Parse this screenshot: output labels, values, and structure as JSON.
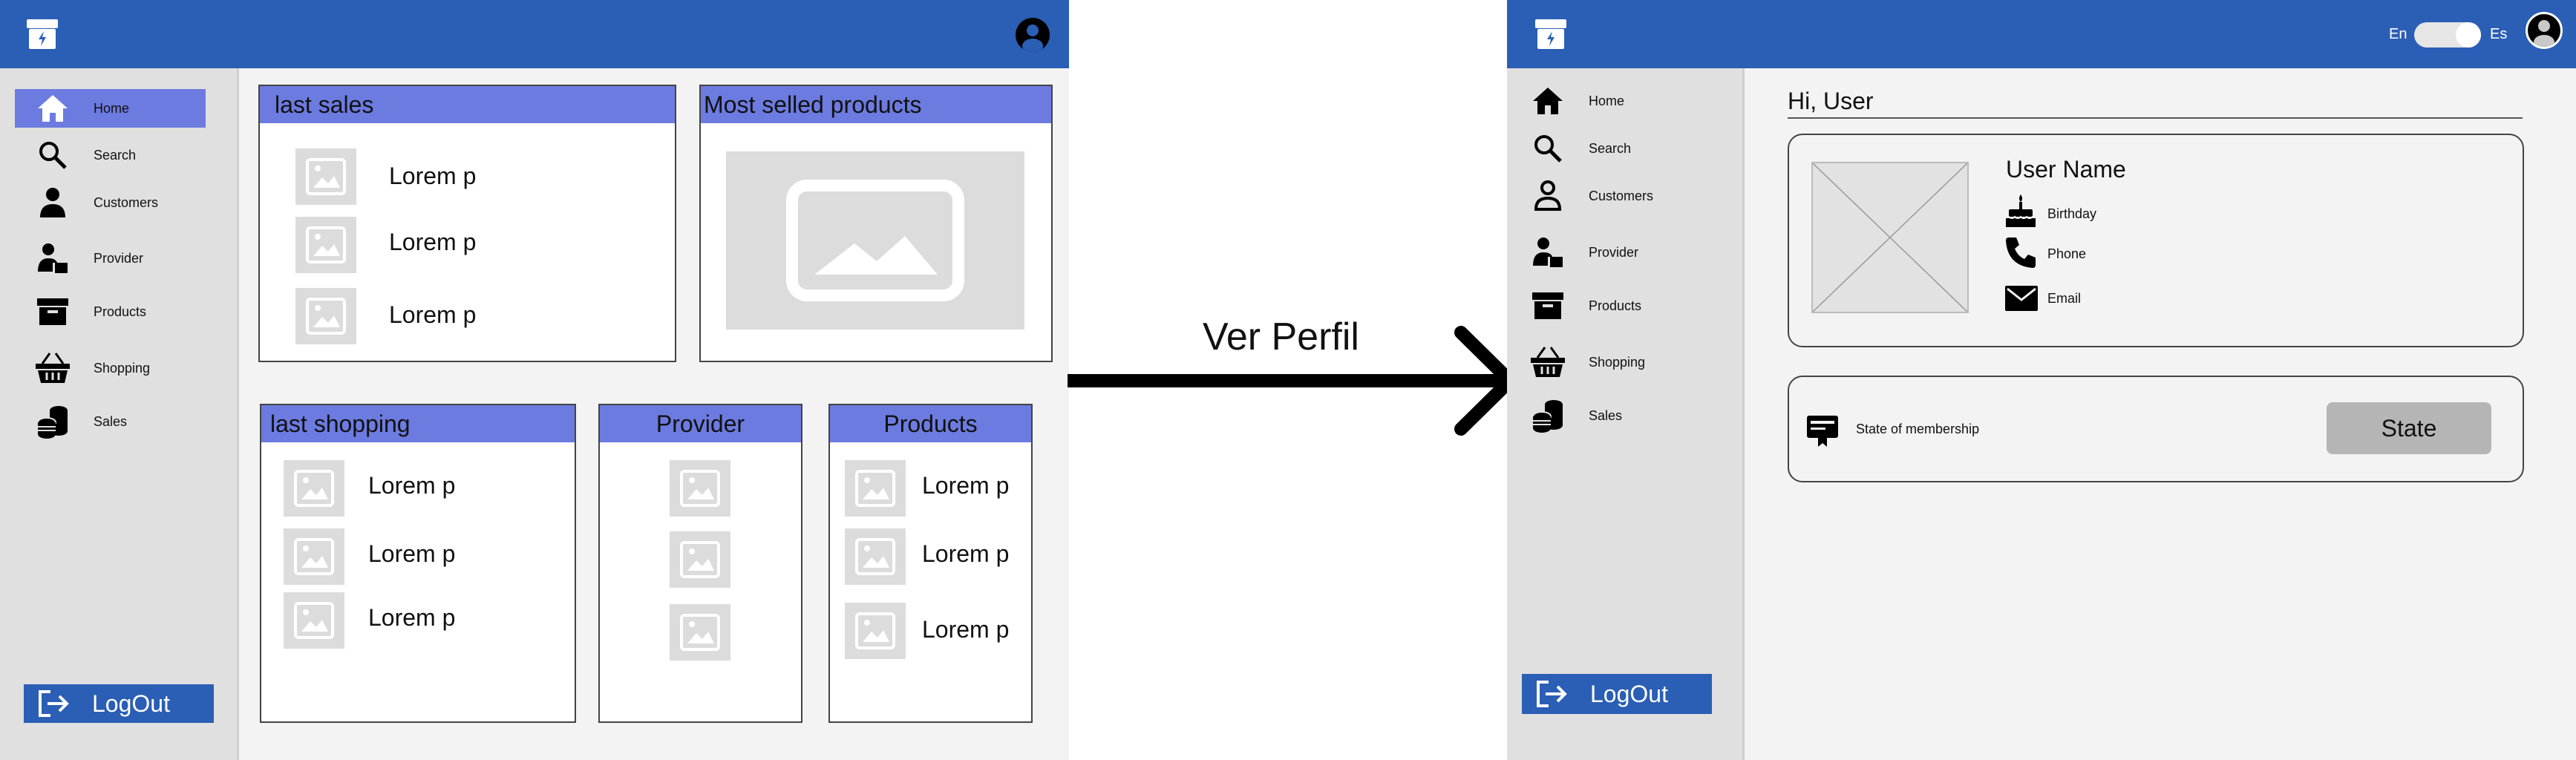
{
  "left_screen": {
    "nav": [
      {
        "label": "Home",
        "icon": "home-icon",
        "active": true
      },
      {
        "label": "Search",
        "icon": "search-icon"
      },
      {
        "label": "Customers",
        "icon": "person-icon"
      },
      {
        "label": "Provider",
        "icon": "provider-icon"
      },
      {
        "label": "Products",
        "icon": "archive-box-icon"
      },
      {
        "label": "Shopping",
        "icon": "shopping-basket-icon"
      },
      {
        "label": "Sales",
        "icon": "coins-icon"
      }
    ],
    "logout_label": "LogOut",
    "last_sales": {
      "title": "last sales",
      "items": [
        "Lorem p",
        "Lorem p",
        "Lorem p"
      ]
    },
    "most_selled": {
      "title": "Most selled products"
    },
    "last_shopping": {
      "title": "last shopping",
      "items": [
        "Lorem p",
        "Lorem p",
        "Lorem p"
      ]
    },
    "provider": {
      "title": "Provider"
    },
    "products": {
      "title": "Products",
      "items": [
        "Lorem p",
        "Lorem p",
        "Lorem p"
      ]
    }
  },
  "arrow_label": "Ver Perfil",
  "right_screen": {
    "lang_left": "En",
    "lang_right": "Es",
    "nav": [
      {
        "label": "Home",
        "icon": "home-icon"
      },
      {
        "label": "Search",
        "icon": "search-icon"
      },
      {
        "label": "Customers",
        "icon": "person-outline-icon"
      },
      {
        "label": "Provider",
        "icon": "provider-icon"
      },
      {
        "label": "Products",
        "icon": "archive-box-icon"
      },
      {
        "label": "Shopping",
        "icon": "shopping-basket-icon"
      },
      {
        "label": "Sales",
        "icon": "coins-icon"
      }
    ],
    "logout_label": "LogOut",
    "greeting": "Hi, User",
    "profile": {
      "name": "User Name",
      "fields": [
        {
          "label": "Birthday",
          "icon": "cake-icon"
        },
        {
          "label": "Phone",
          "icon": "phone-icon"
        },
        {
          "label": "Email",
          "icon": "envelope-icon"
        }
      ]
    },
    "membership": {
      "label": "State of membership",
      "button": "State"
    }
  },
  "colors": {
    "topbar": "#2b5eb5",
    "accent": "#6c7be0",
    "sidebar": "#e0e0e0",
    "main": "#f3f3f3"
  }
}
